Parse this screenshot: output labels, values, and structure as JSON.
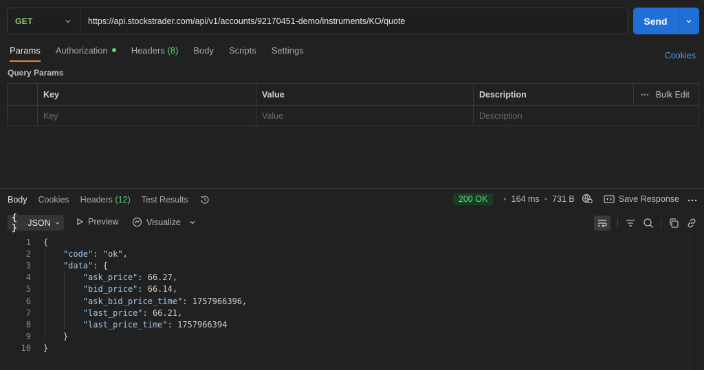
{
  "request": {
    "method": "GET",
    "url": "https://api.stockstrader.com/api/v1/accounts/92170451-demo/instruments/KO/quote",
    "send_label": "Send"
  },
  "request_tabs": {
    "params": "Params",
    "authorization": "Authorization",
    "headers": "Headers",
    "headers_count": "(8)",
    "body": "Body",
    "scripts": "Scripts",
    "settings": "Settings",
    "cookies": "Cookies"
  },
  "query_params": {
    "title": "Query Params",
    "headers": {
      "key": "Key",
      "value": "Value",
      "description": "Description",
      "bulk_edit": "Bulk Edit"
    },
    "placeholders": {
      "key": "Key",
      "value": "Value",
      "description": "Description"
    }
  },
  "response_tabs": {
    "body": "Body",
    "cookies": "Cookies",
    "headers": "Headers",
    "headers_count": "(12)",
    "test_results": "Test Results"
  },
  "response_status": {
    "status": "200 OK",
    "time": "164 ms",
    "size": "731 B",
    "save_response": "Save Response"
  },
  "response_toolbar": {
    "format": "JSON",
    "preview": "Preview",
    "visualize": "Visualize"
  },
  "code_lines": [
    {
      "n": "1",
      "t": "{"
    },
    {
      "n": "2",
      "t": "    \"code\": \"ok\","
    },
    {
      "n": "3",
      "t": "    \"data\": {"
    },
    {
      "n": "4",
      "t": "        \"ask_price\": 66.27,"
    },
    {
      "n": "5",
      "t": "        \"bid_price\": 66.14,"
    },
    {
      "n": "6",
      "t": "        \"ask_bid_price_time\": 1757966396,"
    },
    {
      "n": "7",
      "t": "        \"last_price\": 66.21,"
    },
    {
      "n": "8",
      "t": "        \"last_price_time\": 1757966394"
    },
    {
      "n": "9",
      "t": "    }"
    },
    {
      "n": "10",
      "t": "}"
    }
  ],
  "colors": {
    "accent": "#1f6fd8",
    "tab_underline": "#e8843a",
    "status_ok": "#6fda84",
    "method_get": "#8ecf7a",
    "json_key": "#9cc6f0"
  }
}
